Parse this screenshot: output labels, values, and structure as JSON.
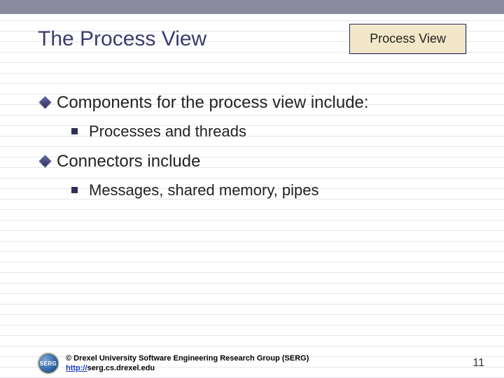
{
  "header": {
    "title": "The Process View",
    "badge": "Process View"
  },
  "bullets": [
    {
      "text": "Components for the process view include:",
      "sub": [
        "Processes and threads"
      ]
    },
    {
      "text": "Connectors include",
      "sub": [
        "Messages, shared memory, pipes"
      ]
    }
  ],
  "footer": {
    "logo_text": "SERG",
    "copyright": "© Drexel University Software Engineering Research Group (SERG)",
    "link_text": "http://",
    "link_rest": "serg.cs.drexel.edu",
    "page_number": "11"
  }
}
